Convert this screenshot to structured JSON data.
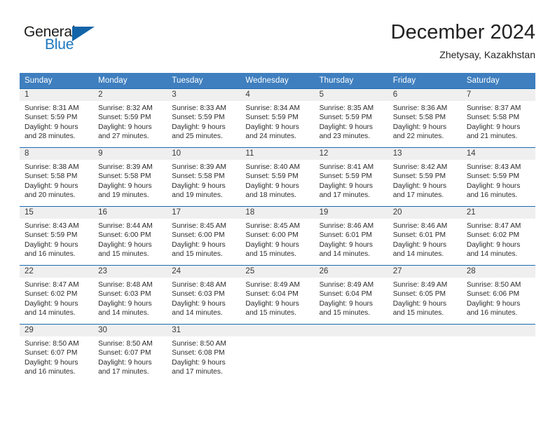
{
  "brand": {
    "name_part1": "General",
    "name_part2": "Blue",
    "accent_color": "#1264a8"
  },
  "header": {
    "title": "December 2024",
    "subtitle": "Zhetysay, Kazakhstan"
  },
  "calendar": {
    "header_bg": "#3f7fbf",
    "daynum_bg": "#efefef",
    "rule_color": "#1b6cb0",
    "weekday_headers": [
      "Sunday",
      "Monday",
      "Tuesday",
      "Wednesday",
      "Thursday",
      "Friday",
      "Saturday"
    ],
    "weeks": [
      [
        {
          "day": "1",
          "sunrise": "Sunrise: 8:31 AM",
          "sunset": "Sunset: 5:59 PM",
          "daylight_line1": "Daylight: 9 hours",
          "daylight_line2": "and 28 minutes."
        },
        {
          "day": "2",
          "sunrise": "Sunrise: 8:32 AM",
          "sunset": "Sunset: 5:59 PM",
          "daylight_line1": "Daylight: 9 hours",
          "daylight_line2": "and 27 minutes."
        },
        {
          "day": "3",
          "sunrise": "Sunrise: 8:33 AM",
          "sunset": "Sunset: 5:59 PM",
          "daylight_line1": "Daylight: 9 hours",
          "daylight_line2": "and 25 minutes."
        },
        {
          "day": "4",
          "sunrise": "Sunrise: 8:34 AM",
          "sunset": "Sunset: 5:59 PM",
          "daylight_line1": "Daylight: 9 hours",
          "daylight_line2": "and 24 minutes."
        },
        {
          "day": "5",
          "sunrise": "Sunrise: 8:35 AM",
          "sunset": "Sunset: 5:59 PM",
          "daylight_line1": "Daylight: 9 hours",
          "daylight_line2": "and 23 minutes."
        },
        {
          "day": "6",
          "sunrise": "Sunrise: 8:36 AM",
          "sunset": "Sunset: 5:58 PM",
          "daylight_line1": "Daylight: 9 hours",
          "daylight_line2": "and 22 minutes."
        },
        {
          "day": "7",
          "sunrise": "Sunrise: 8:37 AM",
          "sunset": "Sunset: 5:58 PM",
          "daylight_line1": "Daylight: 9 hours",
          "daylight_line2": "and 21 minutes."
        }
      ],
      [
        {
          "day": "8",
          "sunrise": "Sunrise: 8:38 AM",
          "sunset": "Sunset: 5:58 PM",
          "daylight_line1": "Daylight: 9 hours",
          "daylight_line2": "and 20 minutes."
        },
        {
          "day": "9",
          "sunrise": "Sunrise: 8:39 AM",
          "sunset": "Sunset: 5:58 PM",
          "daylight_line1": "Daylight: 9 hours",
          "daylight_line2": "and 19 minutes."
        },
        {
          "day": "10",
          "sunrise": "Sunrise: 8:39 AM",
          "sunset": "Sunset: 5:58 PM",
          "daylight_line1": "Daylight: 9 hours",
          "daylight_line2": "and 19 minutes."
        },
        {
          "day": "11",
          "sunrise": "Sunrise: 8:40 AM",
          "sunset": "Sunset: 5:59 PM",
          "daylight_line1": "Daylight: 9 hours",
          "daylight_line2": "and 18 minutes."
        },
        {
          "day": "12",
          "sunrise": "Sunrise: 8:41 AM",
          "sunset": "Sunset: 5:59 PM",
          "daylight_line1": "Daylight: 9 hours",
          "daylight_line2": "and 17 minutes."
        },
        {
          "day": "13",
          "sunrise": "Sunrise: 8:42 AM",
          "sunset": "Sunset: 5:59 PM",
          "daylight_line1": "Daylight: 9 hours",
          "daylight_line2": "and 17 minutes."
        },
        {
          "day": "14",
          "sunrise": "Sunrise: 8:43 AM",
          "sunset": "Sunset: 5:59 PM",
          "daylight_line1": "Daylight: 9 hours",
          "daylight_line2": "and 16 minutes."
        }
      ],
      [
        {
          "day": "15",
          "sunrise": "Sunrise: 8:43 AM",
          "sunset": "Sunset: 5:59 PM",
          "daylight_line1": "Daylight: 9 hours",
          "daylight_line2": "and 16 minutes."
        },
        {
          "day": "16",
          "sunrise": "Sunrise: 8:44 AM",
          "sunset": "Sunset: 6:00 PM",
          "daylight_line1": "Daylight: 9 hours",
          "daylight_line2": "and 15 minutes."
        },
        {
          "day": "17",
          "sunrise": "Sunrise: 8:45 AM",
          "sunset": "Sunset: 6:00 PM",
          "daylight_line1": "Daylight: 9 hours",
          "daylight_line2": "and 15 minutes."
        },
        {
          "day": "18",
          "sunrise": "Sunrise: 8:45 AM",
          "sunset": "Sunset: 6:00 PM",
          "daylight_line1": "Daylight: 9 hours",
          "daylight_line2": "and 15 minutes."
        },
        {
          "day": "19",
          "sunrise": "Sunrise: 8:46 AM",
          "sunset": "Sunset: 6:01 PM",
          "daylight_line1": "Daylight: 9 hours",
          "daylight_line2": "and 14 minutes."
        },
        {
          "day": "20",
          "sunrise": "Sunrise: 8:46 AM",
          "sunset": "Sunset: 6:01 PM",
          "daylight_line1": "Daylight: 9 hours",
          "daylight_line2": "and 14 minutes."
        },
        {
          "day": "21",
          "sunrise": "Sunrise: 8:47 AM",
          "sunset": "Sunset: 6:02 PM",
          "daylight_line1": "Daylight: 9 hours",
          "daylight_line2": "and 14 minutes."
        }
      ],
      [
        {
          "day": "22",
          "sunrise": "Sunrise: 8:47 AM",
          "sunset": "Sunset: 6:02 PM",
          "daylight_line1": "Daylight: 9 hours",
          "daylight_line2": "and 14 minutes."
        },
        {
          "day": "23",
          "sunrise": "Sunrise: 8:48 AM",
          "sunset": "Sunset: 6:03 PM",
          "daylight_line1": "Daylight: 9 hours",
          "daylight_line2": "and 14 minutes."
        },
        {
          "day": "24",
          "sunrise": "Sunrise: 8:48 AM",
          "sunset": "Sunset: 6:03 PM",
          "daylight_line1": "Daylight: 9 hours",
          "daylight_line2": "and 14 minutes."
        },
        {
          "day": "25",
          "sunrise": "Sunrise: 8:49 AM",
          "sunset": "Sunset: 6:04 PM",
          "daylight_line1": "Daylight: 9 hours",
          "daylight_line2": "and 15 minutes."
        },
        {
          "day": "26",
          "sunrise": "Sunrise: 8:49 AM",
          "sunset": "Sunset: 6:04 PM",
          "daylight_line1": "Daylight: 9 hours",
          "daylight_line2": "and 15 minutes."
        },
        {
          "day": "27",
          "sunrise": "Sunrise: 8:49 AM",
          "sunset": "Sunset: 6:05 PM",
          "daylight_line1": "Daylight: 9 hours",
          "daylight_line2": "and 15 minutes."
        },
        {
          "day": "28",
          "sunrise": "Sunrise: 8:50 AM",
          "sunset": "Sunset: 6:06 PM",
          "daylight_line1": "Daylight: 9 hours",
          "daylight_line2": "and 16 minutes."
        }
      ],
      [
        {
          "day": "29",
          "sunrise": "Sunrise: 8:50 AM",
          "sunset": "Sunset: 6:07 PM",
          "daylight_line1": "Daylight: 9 hours",
          "daylight_line2": "and 16 minutes."
        },
        {
          "day": "30",
          "sunrise": "Sunrise: 8:50 AM",
          "sunset": "Sunset: 6:07 PM",
          "daylight_line1": "Daylight: 9 hours",
          "daylight_line2": "and 17 minutes."
        },
        {
          "day": "31",
          "sunrise": "Sunrise: 8:50 AM",
          "sunset": "Sunset: 6:08 PM",
          "daylight_line1": "Daylight: 9 hours",
          "daylight_line2": "and 17 minutes."
        },
        {
          "day": "",
          "sunrise": "",
          "sunset": "",
          "daylight_line1": "",
          "daylight_line2": ""
        },
        {
          "day": "",
          "sunrise": "",
          "sunset": "",
          "daylight_line1": "",
          "daylight_line2": ""
        },
        {
          "day": "",
          "sunrise": "",
          "sunset": "",
          "daylight_line1": "",
          "daylight_line2": ""
        },
        {
          "day": "",
          "sunrise": "",
          "sunset": "",
          "daylight_line1": "",
          "daylight_line2": ""
        }
      ]
    ]
  }
}
